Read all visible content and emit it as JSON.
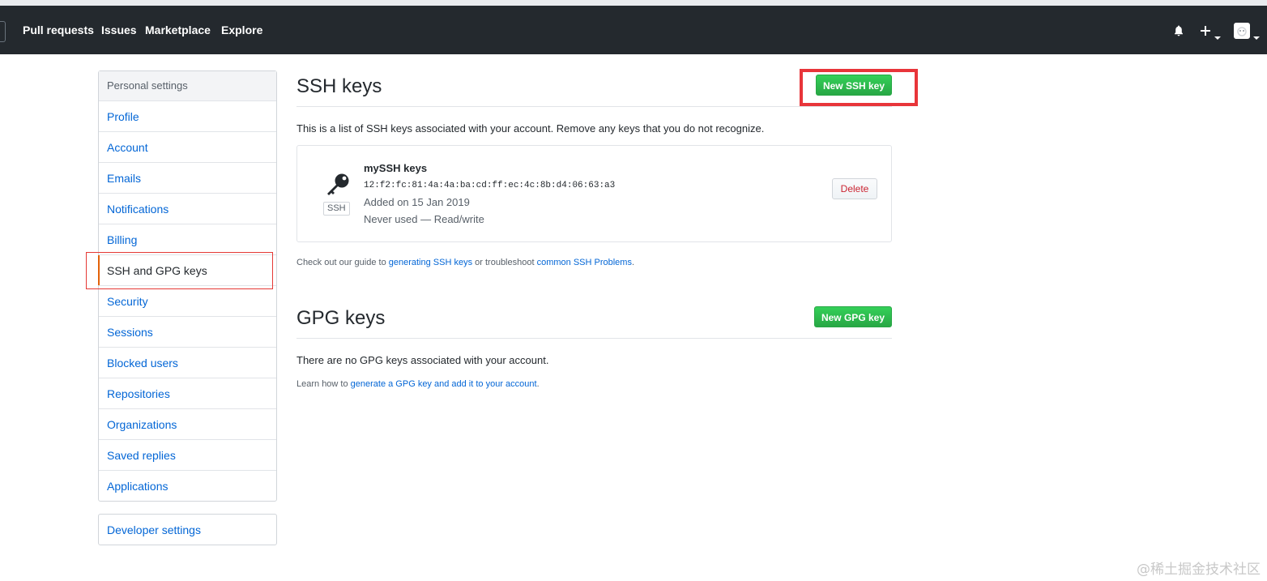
{
  "header": {
    "nav": [
      "Pull requests",
      "Issues",
      "Marketplace",
      "Explore"
    ],
    "icons": [
      "bell-icon",
      "plus-icon",
      "avatar"
    ]
  },
  "sidebar": {
    "heading": "Personal settings",
    "items": [
      {
        "label": "Profile"
      },
      {
        "label": "Account"
      },
      {
        "label": "Emails"
      },
      {
        "label": "Notifications"
      },
      {
        "label": "Billing"
      },
      {
        "label": "SSH and GPG keys",
        "selected": true
      },
      {
        "label": "Security"
      },
      {
        "label": "Sessions"
      },
      {
        "label": "Blocked users"
      },
      {
        "label": "Repositories"
      },
      {
        "label": "Organizations"
      },
      {
        "label": "Saved replies"
      },
      {
        "label": "Applications"
      }
    ],
    "developer": "Developer settings"
  },
  "ssh": {
    "title": "SSH keys",
    "new_button": "New SSH key",
    "intro": "This is a list of SSH keys associated with your account. Remove any keys that you do not recognize.",
    "key": {
      "name": "mySSH keys",
      "fingerprint": "12:f2:fc:81:4a:4a:ba:cd:ff:ec:4c:8b:d4:06:63:a3",
      "added": "Added on 15 Jan 2019",
      "usage": "Never used — Read/write",
      "badge": "SSH",
      "delete": "Delete"
    },
    "guide": {
      "prefix": "Check out our guide to ",
      "link1": "generating SSH keys",
      "middle": " or troubleshoot ",
      "link2": "common SSH Problems",
      "suffix": "."
    }
  },
  "gpg": {
    "title": "GPG keys",
    "new_button": "New GPG key",
    "empty": "There are no GPG keys associated with your account.",
    "learn_prefix": "Learn how to ",
    "learn_link": "generate a GPG key and add it to your account",
    "learn_suffix": "."
  },
  "watermark": "@稀土掘金技术社区",
  "colors": {
    "header": "#24292e",
    "link": "#0366d6",
    "green": "#28a745",
    "highlight": "#e8353a"
  }
}
